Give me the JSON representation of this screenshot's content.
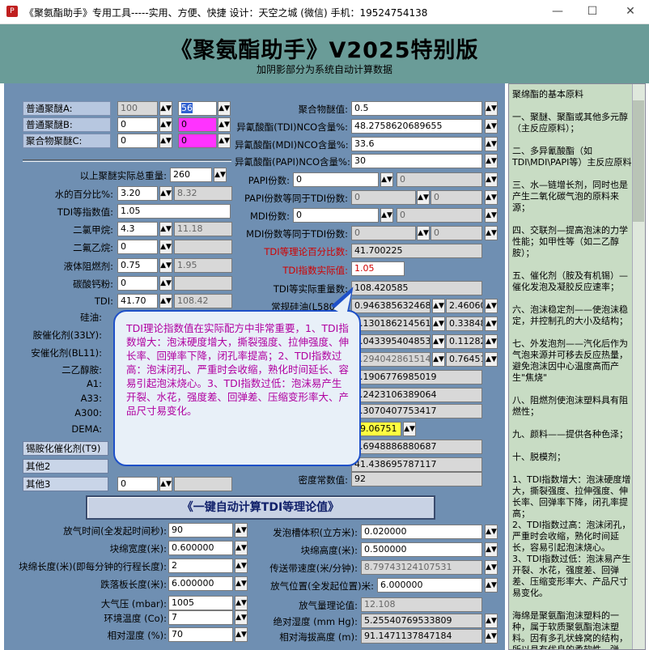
{
  "window": {
    "title": "《聚氨酯助手》专用工具-----实用、方便、快捷    设计：天空之城    (微信) 手机：19524754138",
    "minimize": "—",
    "maximize": "☐",
    "close": "✕"
  },
  "header": {
    "title": "《聚氨酯助手》V2025特别版",
    "subtitle": "加阴影部分为系统自动计算数据"
  },
  "left": {
    "polyA": {
      "label": "普通聚醚A:",
      "v1": "100",
      "v2": "56"
    },
    "polyB": {
      "label": "普通聚醚B:",
      "v1": "0",
      "v2": "0"
    },
    "polyC": {
      "label": "聚合物聚醚C:",
      "v1": "0",
      "v2": "0"
    },
    "total_weight": {
      "label": "以上聚醚实际总重量:",
      "value": "260"
    },
    "water": {
      "label": "水的百分比%:",
      "v1": "3.20",
      "v2": "8.32"
    },
    "tdi_index": {
      "label": "TDI等指数值:",
      "value": "1.05"
    },
    "dcm": {
      "label": "二氯甲烷:",
      "v1": "4.3",
      "v2": "11.18"
    },
    "dfe": {
      "label": "二氟乙烷:",
      "value": "0"
    },
    "flame": {
      "label": "液体阻燃剂:",
      "v1": "0.75",
      "v2": "1.95"
    },
    "caco3": {
      "label": "碳酸钙粉:",
      "value": "0"
    },
    "tdi": {
      "label": "TDI:",
      "v1": "41.70",
      "v2": "108.42"
    },
    "silicone": {
      "label": "硅油:"
    },
    "amine33": {
      "label": "胺催化剂(33LY):"
    },
    "bl11": {
      "label": "安催化剂(BL11):"
    },
    "deoa": {
      "label": "二乙醇胺:"
    },
    "a1": {
      "label": "A1:"
    },
    "a33": {
      "label": "A33:"
    },
    "a300": {
      "label": "A300:"
    },
    "dema": {
      "label": "DEMA:"
    },
    "t9": {
      "label": "锡胺化催化剂(T9)"
    },
    "other2": {
      "label": "其他2"
    },
    "other3": {
      "label": "其他3",
      "value": "0"
    }
  },
  "right": {
    "poly_value": {
      "label": "聚合物醚值:",
      "value": "0.5"
    },
    "tdi_nco": {
      "label": "异氰酸酯(TDI)NCO含量%:",
      "value": "48.2758620689655"
    },
    "mdi_nco": {
      "label": "异氰酸酯(MDI)NCO含量%:",
      "value": "33.6"
    },
    "papi_nco": {
      "label": "异氰酸酯(PAPI)NCO含量%:",
      "value": "30"
    },
    "papi_parts": {
      "label": "PAPI份数:",
      "v1": "0",
      "v2": "0"
    },
    "papi_eq": {
      "label": "PAPI份数等同于TDI份数:",
      "v1": "0",
      "v2": "0"
    },
    "mdi_parts": {
      "label": "MDI份数:",
      "v1": "0",
      "v2": "0"
    },
    "mdi_eq": {
      "label": "MDI份数等同于TDI份数:",
      "v1": "0",
      "v2": "0"
    },
    "tdi_theory_pct": {
      "label": "TDI等理论百分比数:",
      "value": "41.700225"
    },
    "tdi_actual_index": {
      "label": "TDI指数实际值:",
      "value": "1.05"
    },
    "tdi_actual_weight": {
      "label": "TDI等实际重量数:",
      "value": "108.420585"
    },
    "silicone_l580": {
      "label": "常规硅油(L580)理",
      "v1": "0.9463856324689",
      "v2": "2.460608"
    },
    "r1": {
      "v1": "0.1301862145619",
      "v2": "0.338484"
    },
    "r2": {
      "v1": "0.0433954048539",
      "v2": "0.112828"
    },
    "r3": {
      "v1": "0.2940428615142",
      "v2": "0.76451"
    },
    "r4": {
      "value": "0.1906776985019"
    },
    "r5": {
      "value": "0.2423106389064"
    },
    "r6": {
      "value": "0.3070407753417"
    },
    "r7": {
      "value": "39.06751"
    },
    "r8": {
      "value": "0.6948886880687"
    },
    "r9": {
      "value": "41.438695787117"
    },
    "density": {
      "label": "密度常数值:",
      "value": "92"
    }
  },
  "tooltip": {
    "text": "TDI理论指数值在实际配方中非常重要，1、TDI指数增大：泡沫硬度增大，撕裂强度、拉伸强度、伸长率、回弹率下降，闭孔率提高；2、TDI指数过高：泡沫闭孔、严重时会收缩，熟化时间延长、容易引起泡沫烧心。3、TDI指数过低：泡沫易产生开裂、水花，强度差、回弹差、压缩变形率大、产品尺寸易变化。"
  },
  "action": {
    "compute_button": "《一键自动计算TDI等理论值》"
  },
  "bottom": {
    "release_time": {
      "label": "放气时间(全发起时间秒):",
      "value": "90"
    },
    "block_width": {
      "label": "块绵宽度(米):",
      "value": "0.600000"
    },
    "block_length": {
      "label": "块绵长度(米)(即每分钟的行程长度):",
      "value": "2"
    },
    "fall_length": {
      "label": "跌落板长度(米):",
      "value": "6.000000"
    },
    "pressure": {
      "label": "大气压 (mbar):",
      "value": "1005"
    },
    "temperature": {
      "label": "环境温度 (Co):",
      "value": "7"
    },
    "humidity": {
      "label": "相对湿度 (%):",
      "value": "70"
    },
    "trough_volume": {
      "label": "发泡槽体积(立方米):",
      "value": "0.020000"
    },
    "block_height": {
      "label": "块绵高度(米):",
      "value": "0.500000"
    },
    "conveyor_speed": {
      "label": "传送带速度(米/分钟):",
      "value": "8.79743124107531"
    },
    "release_pos": {
      "label": "放气位置(全发起位置)米:",
      "value": "6.000000"
    },
    "gas_theory": {
      "label": "放气量理论值:",
      "value": "12.108"
    },
    "abs_humidity": {
      "label": "绝对湿度 (mm Hg):",
      "value": "5.25540769533809"
    },
    "altitude": {
      "label": "相对海拔高度 (m):",
      "value": "91.1471137847184"
    }
  },
  "side": {
    "text": "聚绵酯的基本原料\n\n一、聚醚、聚酯或其他多元醇（主反应原料）；\n\n二、多异氰酸酯（如TDI\\MDI\\PAPI等）主反应原料\n\n三、水—链增长剂，同时也是产生二氧化碳气泡的原料来源；\n\n四、交联剂—提高泡沫的力学性能；如甲性等（如二乙醇胺）；\n\n五、催化剂（胺及有机锡）—催化发泡及凝胶反应速率；\n\n六、泡沫稳定剂——使泡沫稳定，并控制孔的大小及结构；\n\n七、外发泡剂——汽化后作为气泡来源并可移去反应热量，避免泡沫因中心温度高而产生\"焦烧\"\n\n八、阻燃剂使泡沫塑料具有阻燃性；\n\n九、颜料——提供各种色泽；\n\n十、脱模剂；\n\n1、TDI指数增大：泡沫硬度增大，撕裂强度、拉伸强度、伸长率、回弹率下降，闭孔率提高；\n2、TDI指数过高：泡沫闭孔，严重时会收缩，熟化时间延长，容易引起泡沫烧心。\n3、TDI指数过低：泡沫易产生开裂、水花，强度差、回弹差、压缩变形率大、产品尺寸易变化。\n\n海绵是聚氨酯泡沫塑料的一种，属于软质聚氨酯泡沫塑料。因有多孔状蜂窝的结构，所以具有优良的柔软性、弹性、吸水性"
  }
}
